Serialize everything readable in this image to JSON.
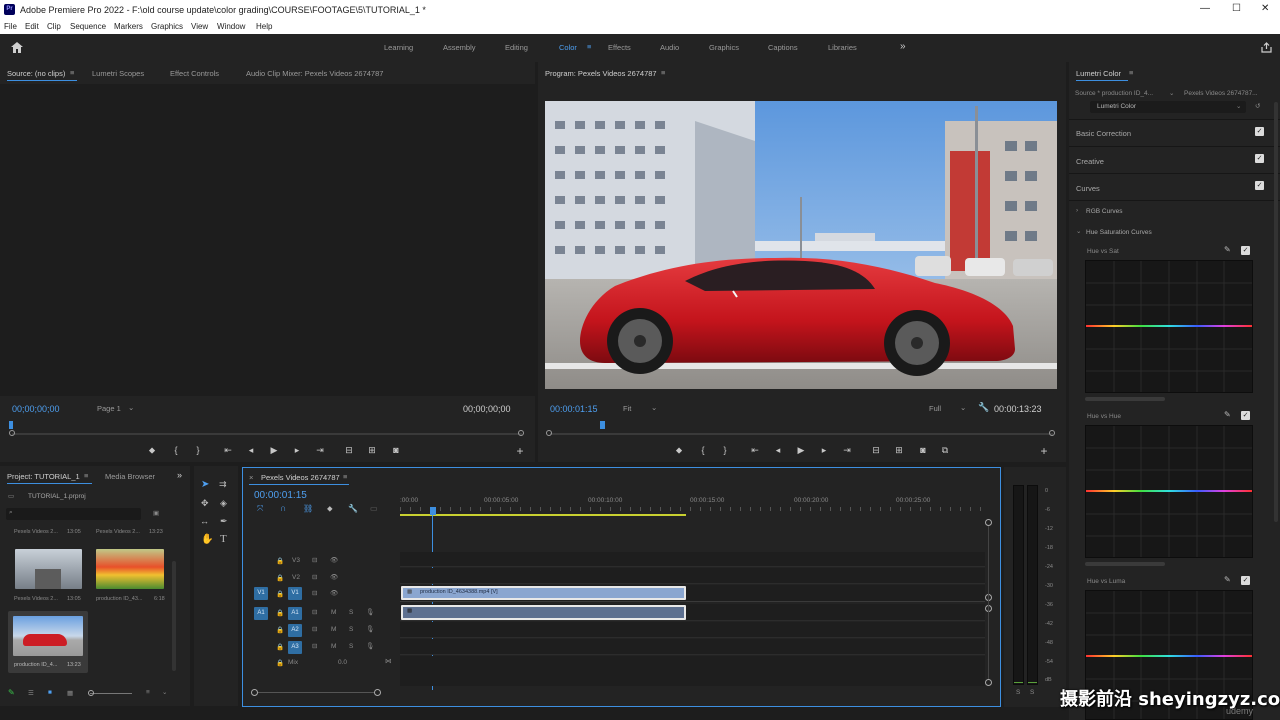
{
  "app": {
    "title": "Adobe Premiere Pro 2022 - F:\\old course update\\color grading\\COURSE\\FOOTAGE\\5\\TUTORIAL_1 *",
    "icon_label": "Pr"
  },
  "window_controls": {
    "minimize": "—",
    "maximize": "☐",
    "close": "✕"
  },
  "menu": [
    "File",
    "Edit",
    "Clip",
    "Sequence",
    "Markers",
    "Graphics",
    "View",
    "Window",
    "Help"
  ],
  "workspaces": {
    "items": [
      "Learning",
      "Assembly",
      "Editing",
      "Color",
      "Effects",
      "Audio",
      "Graphics",
      "Captions",
      "Libraries"
    ],
    "active": "Color",
    "more": "»",
    "menu_icon": "≡"
  },
  "source_panel": {
    "tabs": [
      "Source: (no clips)",
      "Lumetri Scopes",
      "Effect Controls",
      "Audio Clip Mixer: Pexels Videos 2674787"
    ],
    "timecode_left": "00;00;00;00",
    "page": "Page 1",
    "timecode_right": "00;00;00;00"
  },
  "program_panel": {
    "title": "Program: Pexels Videos 2674787",
    "timecode": "00:00:01:15",
    "fit": "Fit",
    "quality": "Full",
    "duration": "00:00:13:23"
  },
  "lumetri": {
    "title": "Lumetri Color",
    "source_label": "Source * production ID_4...",
    "sequence_label": "Pexels Videos 2674787...",
    "preset": "Lumetri Color",
    "sections": [
      "Basic Correction",
      "Creative",
      "Curves"
    ],
    "sub_sections": [
      "RGB Curves",
      "Hue Saturation Curves"
    ],
    "curves": [
      "Hue vs Sat",
      "Hue vs Hue",
      "Hue vs Luma"
    ]
  },
  "project_panel": {
    "tabs": [
      "Project: TUTORIAL_1",
      "Media Browser"
    ],
    "more": "»",
    "project_file": "TUTORIAL_1.prproj",
    "top_items": [
      {
        "name": "Pexels Videos 2...",
        "duration": "13:05"
      },
      {
        "name": "Pexels Videos 2...",
        "duration": "13:23"
      }
    ],
    "items": [
      {
        "name": "Pexels Videos 2...",
        "duration": "13:05"
      },
      {
        "name": "production ID_43...",
        "duration": "6:18"
      },
      {
        "name": "production ID_4...",
        "duration": "13:23"
      }
    ]
  },
  "timeline": {
    "title": "Pexels Videos 2674787",
    "timecode": "00:00:01:15",
    "ruler": [
      ":00:00",
      "00:00:05:00",
      "00:00:10:00",
      "00:00:15:00",
      "00:00:20:00",
      "00:00:25:00"
    ],
    "video_tracks": [
      "V3",
      "V2",
      "V1"
    ],
    "audio_tracks": [
      "A1",
      "A2",
      "A3"
    ],
    "source_patch_video": "V1",
    "source_patch_audio": "A1",
    "mix_label": "Mix",
    "mix_value": "0.0",
    "clip_name": "production ID_4634388.mp4 [V]",
    "mute": "M",
    "solo": "S"
  },
  "audio_meter": {
    "scale": [
      "0",
      "-6",
      "-12",
      "-18",
      "-24",
      "-30",
      "-36",
      "-42",
      "-48",
      "-54",
      "dB"
    ],
    "solo_labels": [
      "S",
      "S"
    ]
  },
  "watermark": "摄影前沿 sheyingzyz.com",
  "watermark_small": "udemy",
  "colors": {
    "accent": "#3d8fe0",
    "clip_video": "#8aa6d0",
    "track_button": "#2f6ea3"
  }
}
